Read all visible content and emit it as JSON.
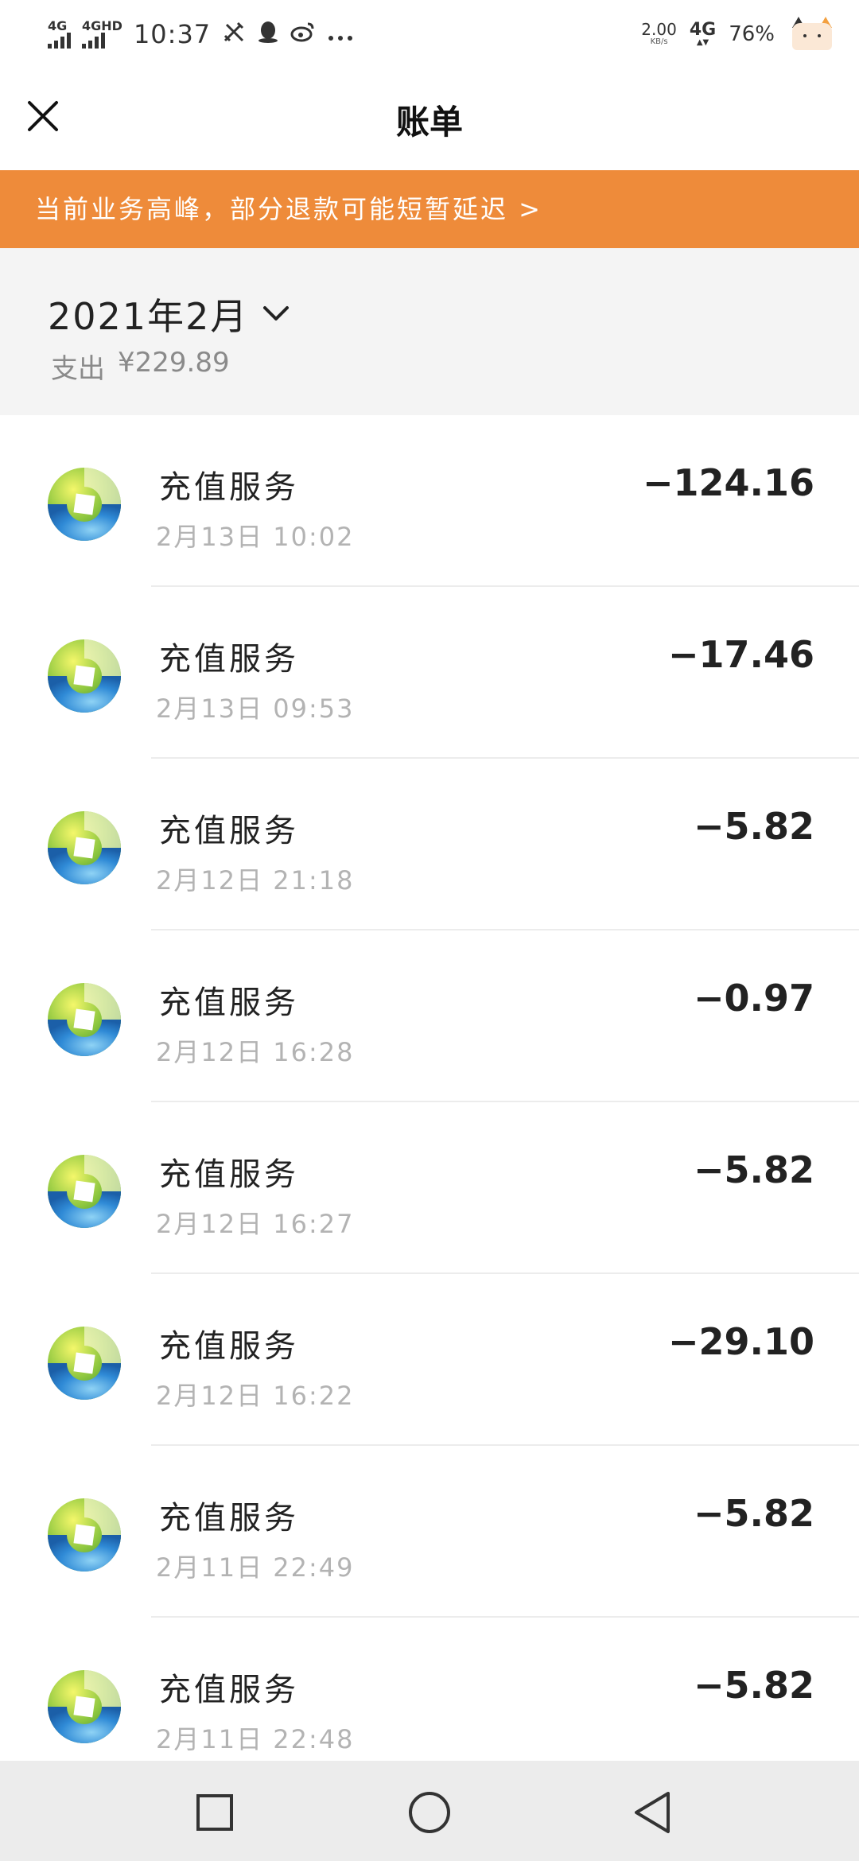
{
  "status_bar": {
    "sim1": "4G",
    "sim2": "4GHD",
    "time": "10:37",
    "net_speed_value": "2.00",
    "net_speed_unit": "KB/s",
    "network": "4G",
    "battery": "76%"
  },
  "header": {
    "title": "账单"
  },
  "notice": {
    "text": "当前业务高峰，部分退款可能短暂延迟 >"
  },
  "summary": {
    "month": "2021年2月",
    "expense_label": "支出",
    "expense_amount": "¥229.89"
  },
  "transactions": [
    {
      "name": "充值服务",
      "time": "2月13日 10:02",
      "amount": "−124.16"
    },
    {
      "name": "充值服务",
      "time": "2月13日 09:53",
      "amount": "−17.46"
    },
    {
      "name": "充值服务",
      "time": "2月12日 21:18",
      "amount": "−5.82"
    },
    {
      "name": "充值服务",
      "time": "2月12日 16:28",
      "amount": "−0.97"
    },
    {
      "name": "充值服务",
      "time": "2月12日 16:27",
      "amount": "−5.82"
    },
    {
      "name": "充值服务",
      "time": "2月12日 16:22",
      "amount": "−29.10"
    },
    {
      "name": "充值服务",
      "time": "2月11日 22:49",
      "amount": "−5.82"
    },
    {
      "name": "充值服务",
      "time": "2月11日 22:48",
      "amount": "−5.82"
    }
  ],
  "colors": {
    "notice_bg": "#ee8b3a",
    "summary_bg": "#f4f4f4",
    "navbar_bg": "#ececec"
  }
}
